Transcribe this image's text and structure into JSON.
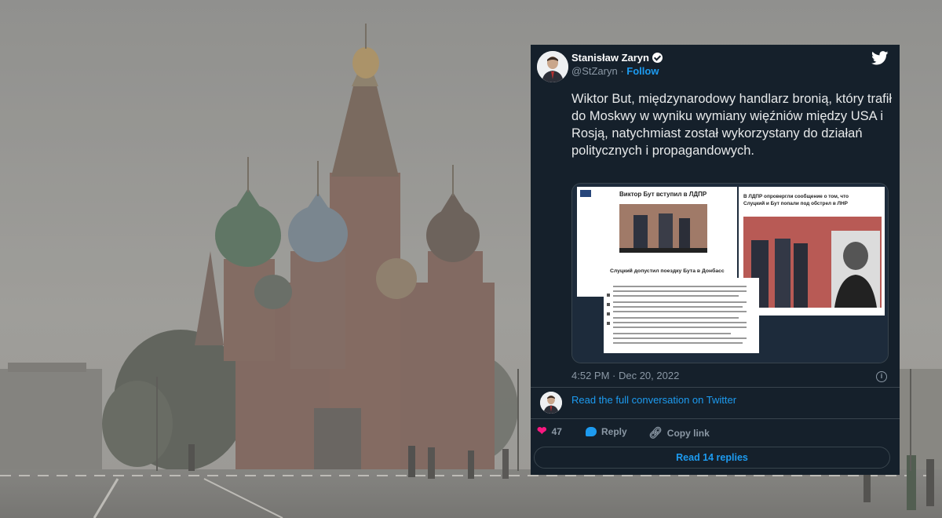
{
  "tweet": {
    "author_name": "Stanisław Zaryn",
    "author_handle": "@StZaryn",
    "follow_label": "Follow",
    "text": "Wiktor But, międzynarodowy handlarz bronią, który trafił do Moskwy w wyniku wymiany więźniów między USA i Rosją, natychmiast został wykorzystany do działań politycznych i propagandowych.",
    "timestamp": "4:52 PM · Dec 20, 2022",
    "conversation_link": "Read the full conversation on Twitter",
    "likes_count": "47",
    "reply_label": "Reply",
    "copy_link_label": "Copy link",
    "read_replies_label": "Read 14 replies"
  },
  "media": {
    "left_headline": "Виктор Бут вступил в ЛДПР",
    "left_subheadline": "Слуцкий допустил поездку Бута в Донбасс",
    "right_headline_1": "В ЛДПР опровергли сообщение о том, что",
    "right_headline_2": "Слуцкий и Бут попали под обстрел в ЛНР"
  },
  "colors": {
    "card_background": "#15202b",
    "accent": "#1d9bf0",
    "like": "#f91880"
  }
}
